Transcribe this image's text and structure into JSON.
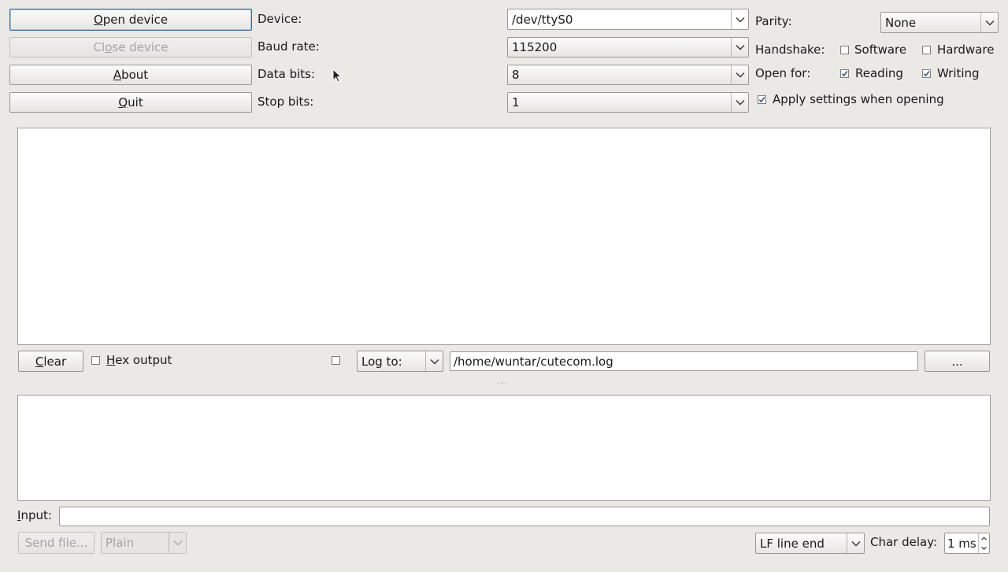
{
  "left_buttons": {
    "open_device": {
      "pre": "",
      "key": "O",
      "post": "pen device"
    },
    "close_device": {
      "pre": "Cl",
      "key": "o",
      "post": "se device"
    },
    "about": {
      "pre": "",
      "key": "A",
      "post": "bout"
    },
    "quit": {
      "pre": "",
      "key": "Q",
      "post": "uit"
    }
  },
  "settings": {
    "device_label": "Device:",
    "device_value": "/dev/ttyS0",
    "baud_label": "Baud rate:",
    "baud_value": "115200",
    "databits_label": "Data bits:",
    "databits_value": "8",
    "stopbits_label": "Stop bits:",
    "stopbits_value": "1",
    "parity_label": "Parity:",
    "parity_value": "None",
    "handshake_label": "Handshake:",
    "handshake_software": "Software",
    "handshake_software_checked": false,
    "handshake_hardware": "Hardware",
    "handshake_hardware_checked": false,
    "open_for_label": "Open for:",
    "reading": "Reading",
    "reading_checked": true,
    "writing": "Writing",
    "writing_checked": true,
    "apply_settings": "Apply settings when opening",
    "apply_settings_checked": true
  },
  "output_bar": {
    "clear": {
      "pre": "",
      "key": "C",
      "post": "lear"
    },
    "hex_output": {
      "pre": "",
      "key": "H",
      "post": "ex output"
    },
    "hex_output_checked": false,
    "log_enabled_checked": false,
    "log_to": "Log to:",
    "log_path": "/home/wuntar/cutecom.log",
    "browse": "..."
  },
  "splitter_handle": "...",
  "input": {
    "label": {
      "pre": "",
      "key": "I",
      "post": "nput:"
    },
    "value": ""
  },
  "bottom_bar": {
    "send_file": "Send file...",
    "plain": "Plain",
    "line_end": "LF line end",
    "char_delay_label": "Char delay:",
    "char_delay_value": "1 ms"
  },
  "icons": {
    "combo_arrow": "chevron-down-icon",
    "spin_up": "chevron-up-icon",
    "check": "check-icon",
    "cursor": "mouse-pointer-icon"
  }
}
